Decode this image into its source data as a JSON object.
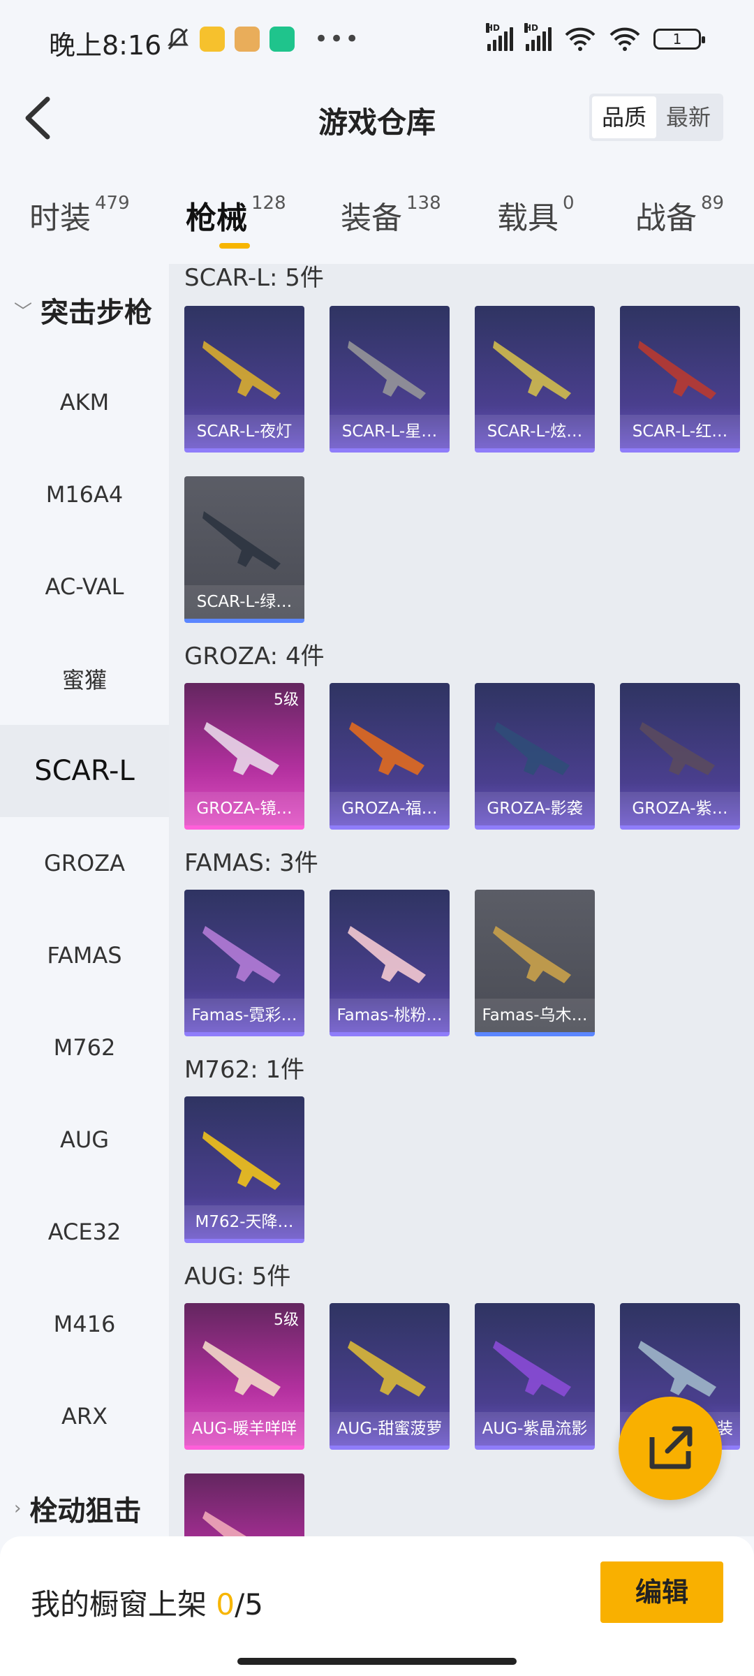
{
  "status_bar": {
    "time": "晚上8:16",
    "battery": "1",
    "signal1_label": "HD",
    "signal2_label": "HD"
  },
  "header": {
    "title": "游戏仓库",
    "sort_options": [
      "品质",
      "最新"
    ],
    "sort_selected": "品质"
  },
  "tabs": [
    {
      "label": "时装",
      "count": "479"
    },
    {
      "label": "枪械",
      "count": "128"
    },
    {
      "label": "装备",
      "count": "138"
    },
    {
      "label": "载具",
      "count": "0"
    },
    {
      "label": "战备",
      "count": "89"
    }
  ],
  "sidebar": {
    "group1": "突击步枪",
    "items": [
      "AKM",
      "M16A4",
      "AC-VAL",
      "蜜獾",
      "SCAR-L",
      "GROZA",
      "FAMAS",
      "M762",
      "AUG",
      "ACE32",
      "M416",
      "ARX"
    ],
    "active": "SCAR-L",
    "group2": "栓动狙击"
  },
  "sections": [
    {
      "title": "SCAR-L: 5件",
      "items": [
        {
          "name": "SCAR-L-夜灯",
          "rarity": "blue"
        },
        {
          "name": "SCAR-L-星…",
          "rarity": "blue"
        },
        {
          "name": "SCAR-L-炫…",
          "rarity": "blue"
        },
        {
          "name": "SCAR-L-红…",
          "rarity": "blue"
        },
        {
          "name": "SCAR-L-绿…",
          "rarity": "gray"
        }
      ]
    },
    {
      "title": "GROZA: 4件",
      "items": [
        {
          "name": "GROZA-镜…",
          "rarity": "pink",
          "level": "5级"
        },
        {
          "name": "GROZA-福…",
          "rarity": "blue"
        },
        {
          "name": "GROZA-影袭",
          "rarity": "blue"
        },
        {
          "name": "GROZA-紫…",
          "rarity": "blue"
        }
      ]
    },
    {
      "title": "FAMAS: 3件",
      "items": [
        {
          "name": "Famas-霓彩…",
          "rarity": "blue"
        },
        {
          "name": "Famas-桃粉…",
          "rarity": "blue"
        },
        {
          "name": "Famas-乌木…",
          "rarity": "gray"
        }
      ]
    },
    {
      "title": "M762: 1件",
      "items": [
        {
          "name": "M762-天降…",
          "rarity": "blue"
        }
      ]
    },
    {
      "title": "AUG: 5件",
      "items": [
        {
          "name": "AUG-暖羊咩咩",
          "rarity": "pink",
          "level": "5级"
        },
        {
          "name": "AUG-甜蜜菠萝",
          "rarity": "blue"
        },
        {
          "name": "AUG-紫晶流影",
          "rarity": "blue"
        },
        {
          "name": "装",
          "rarity": "blue"
        },
        {
          "name": "",
          "rarity": "blue"
        }
      ]
    }
  ],
  "bottom": {
    "showcase_label": "我的橱窗上架",
    "showcase_count": "0",
    "showcase_total": "/5",
    "edit_label": "编辑"
  }
}
